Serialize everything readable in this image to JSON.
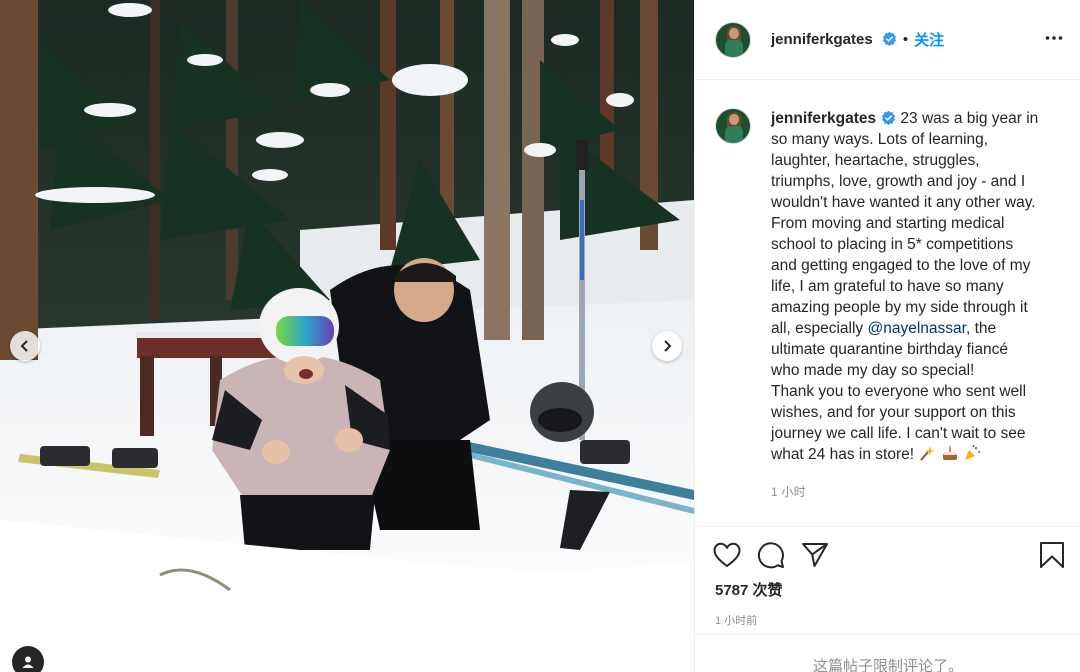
{
  "post": {
    "username": "jenniferkgates",
    "follow_label": "关注",
    "dot": "•",
    "caption_lines": [
      "23 was a big year in",
      "so many ways. Lots of learning,",
      "laughter, heartache, struggles,",
      "triumphs, love, growth and joy - and I",
      "wouldn't have wanted it any other way.",
      "From moving and starting medical",
      "school to placing in 5* competitions",
      "and getting engaged to the love of my",
      "life, I am grateful to have so many",
      "amazing people by my side through it",
      "all, especially ",
      "ultimate quarantine birthday fiancé",
      "who made my day so special!",
      "Thank you to everyone who sent well",
      "wishes, and for your support on this",
      "journey we call life. I can't wait to see",
      "what 24 has in store! "
    ],
    "mention": "@nayelnassar",
    "mention_after": ", the",
    "emojis": [
      "sparkler-emoji",
      "cake-emoji",
      "party-popper-emoji"
    ],
    "caption_time": "1 小时",
    "likes": "5787 次赞",
    "post_time": "1 小时前",
    "comments_limited": "这篇帖子限制评论了。"
  },
  "icons": {
    "verified": "verified-badge-icon",
    "more": "more-options-icon",
    "like": "heart-icon",
    "comment": "comment-icon",
    "share": "paper-plane-icon",
    "save": "bookmark-icon",
    "prev": "chevron-left-icon",
    "next": "chevron-right-icon",
    "tag": "user-tag-icon"
  },
  "colors": {
    "link_blue": "#0095f6",
    "verified_blue": "#3897f0",
    "mention": "#00376b",
    "muted": "#8e8e8e"
  }
}
